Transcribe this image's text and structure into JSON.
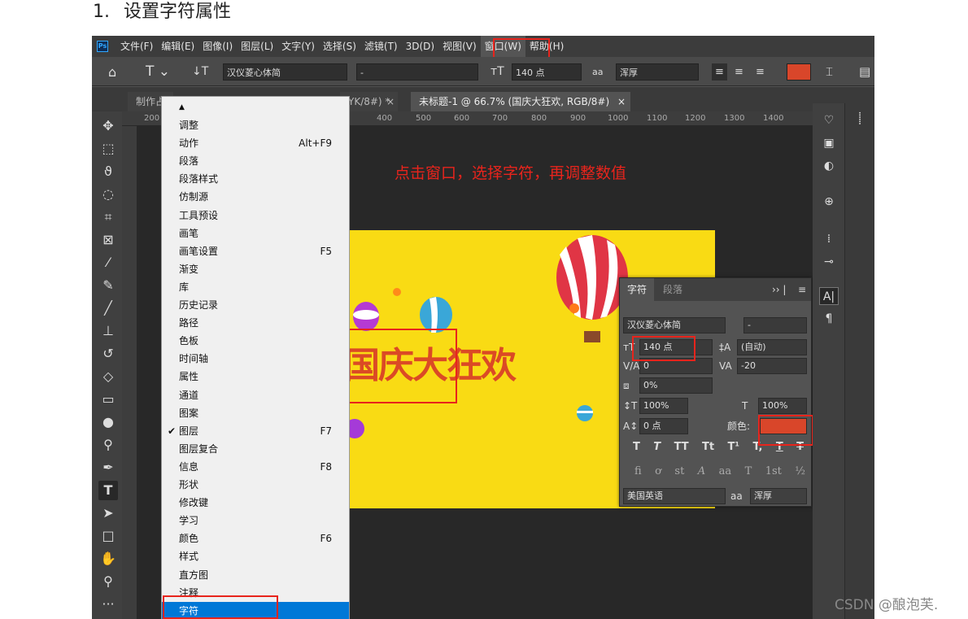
{
  "doc": {
    "heading_num": "1.",
    "heading": "设置字符属性"
  },
  "menubar": {
    "logo": "Ps",
    "items": [
      "文件(F)",
      "编辑(E)",
      "图像(I)",
      "图层(L)",
      "文字(Y)",
      "选择(S)",
      "滤镜(T)",
      "3D(D)",
      "视图(V)",
      "窗口(W)",
      "帮助(H)"
    ]
  },
  "options_bar": {
    "font_family": "汉仪菱心体简",
    "font_style": "-",
    "font_size": "140 点",
    "aa_label": "aa",
    "antialias": "浑厚"
  },
  "tabs": [
    {
      "label": "制作占"
    },
    {
      "label": "YK/8#) *"
    },
    {
      "label": "未标题-1 @ 66.7% (国庆大狂欢, RGB/8#) *"
    }
  ],
  "ruler": {
    "h_ticks": [
      "200",
      "400",
      "500",
      "600",
      "700",
      "800",
      "900",
      "1000",
      "1100",
      "1200",
      "1300",
      "1400"
    ],
    "zoom": "66.67%"
  },
  "window_menu": {
    "items": [
      {
        "label": "调整",
        "shortcut": ""
      },
      {
        "label": "动作",
        "shortcut": "Alt+F9"
      },
      {
        "label": "段落",
        "shortcut": ""
      },
      {
        "label": "段落样式",
        "shortcut": ""
      },
      {
        "label": "仿制源",
        "shortcut": ""
      },
      {
        "label": "工具预设",
        "shortcut": ""
      },
      {
        "label": "画笔",
        "shortcut": ""
      },
      {
        "label": "画笔设置",
        "shortcut": "F5"
      },
      {
        "label": "渐变",
        "shortcut": ""
      },
      {
        "label": "库",
        "shortcut": ""
      },
      {
        "label": "历史记录",
        "shortcut": ""
      },
      {
        "label": "路径",
        "shortcut": ""
      },
      {
        "label": "色板",
        "shortcut": ""
      },
      {
        "label": "时间轴",
        "shortcut": ""
      },
      {
        "label": "属性",
        "shortcut": ""
      },
      {
        "label": "通道",
        "shortcut": ""
      },
      {
        "label": "图案",
        "shortcut": ""
      },
      {
        "label": "图层",
        "shortcut": "F7",
        "checked": true
      },
      {
        "label": "图层复合",
        "shortcut": ""
      },
      {
        "label": "信息",
        "shortcut": "F8"
      },
      {
        "label": "形状",
        "shortcut": ""
      },
      {
        "label": "修改键",
        "shortcut": ""
      },
      {
        "label": "学习",
        "shortcut": ""
      },
      {
        "label": "颜色",
        "shortcut": "F6"
      },
      {
        "label": "样式",
        "shortcut": ""
      },
      {
        "label": "直方图",
        "shortcut": ""
      },
      {
        "label": "注释",
        "shortcut": ""
      },
      {
        "label": "字符",
        "shortcut": "",
        "selected": true
      }
    ]
  },
  "canvas": {
    "annotation": "点击窗口，选择字符，再调整数值",
    "promo_text": "国庆大狂欢",
    "promo_color": "#db4a25",
    "bg_color": "#f9db14"
  },
  "char_panel": {
    "tab_char": "字符",
    "tab_para": "段落",
    "font_family": "汉仪菱心体简",
    "font_style": "-",
    "font_size": "140 点",
    "leading": "(自动)",
    "kerning": "0",
    "tracking": "-20",
    "tsume": "0%",
    "vscale": "100%",
    "hscale": "100%",
    "baseline": "0 点",
    "color_label": "颜色:",
    "color": "#d9462a",
    "language": "美国英语",
    "aa_label": "aa",
    "antialias": "浑厚",
    "style_buttons": [
      "T",
      "T",
      "TT",
      "Tt",
      "T¹",
      "T,",
      "T",
      "T"
    ],
    "opentype_buttons": [
      "fi",
      "ơ",
      "st",
      "A",
      "aa",
      "T",
      "1st",
      "½"
    ]
  },
  "watermark": "CSDN @酿泡芙."
}
